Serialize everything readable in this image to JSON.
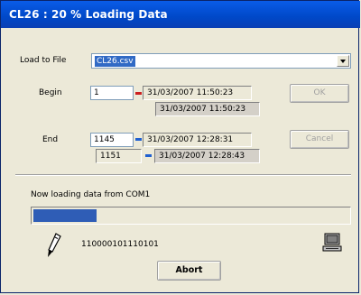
{
  "window": {
    "title": "CL26 : 20 % Loading Data"
  },
  "load_to_file": {
    "label": "Load to File",
    "value": "CL26.csv"
  },
  "begin": {
    "label": "Begin",
    "index": "1",
    "time": "31/03/2007  11:50:23",
    "sub_time": "31/03/2007  11:50:23",
    "marker_color": "#cc2020"
  },
  "end": {
    "label": "End",
    "index": "1145",
    "time": "31/03/2007  12:28:31",
    "sub_index": "1151",
    "sub_time": "31/03/2007  12:28:43",
    "marker_color": "#2060d0"
  },
  "buttons": {
    "ok": "OK",
    "cancel": "Cancel",
    "abort": "Abort"
  },
  "status": {
    "text": "Now loading data from COM1",
    "progress": 0.2,
    "progress_color": "#2f5db6"
  },
  "transfer": {
    "bits": "110000101110101"
  },
  "icons": {
    "probe": "pen-probe-icon",
    "computer": "computer-icon"
  }
}
